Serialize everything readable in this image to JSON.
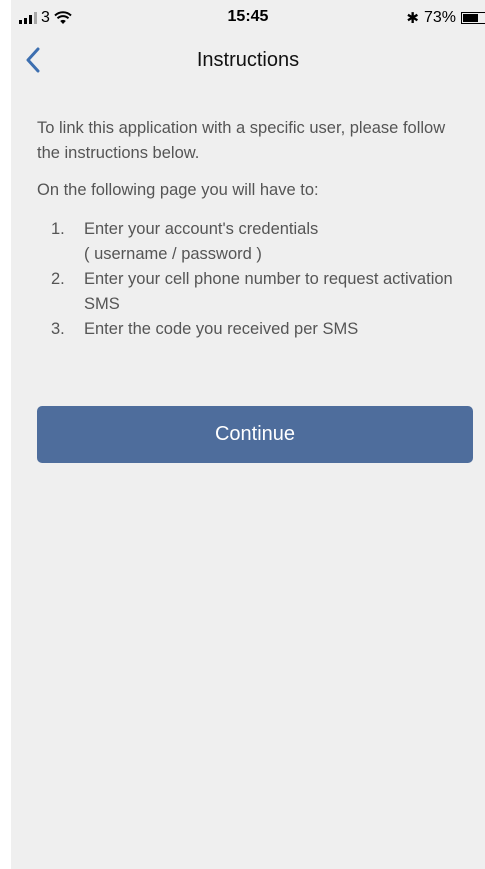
{
  "status_bar": {
    "carrier": "3",
    "time": "15:45",
    "bluetooth_icon": "bluetooth-icon",
    "battery_percent": "73%",
    "battery_level": 0.73
  },
  "nav": {
    "back_icon": "chevron-left-icon",
    "title": "Instructions"
  },
  "content": {
    "intro": "To link this application with a specific user, please follow the instructions below.",
    "lead": "On the following page you will have to:",
    "steps": [
      {
        "num": "1.",
        "text": "Enter your account's credentials\n( username / password )"
      },
      {
        "num": "2.",
        "text": "Enter your cell phone number to request activation SMS"
      },
      {
        "num": "3.",
        "text": "Enter the code you received per SMS"
      }
    ]
  },
  "continue_button": {
    "label": "Continue",
    "color": "#4e6d9c"
  },
  "colors": {
    "background": "#efefef",
    "accent": "#3d6fb0"
  }
}
